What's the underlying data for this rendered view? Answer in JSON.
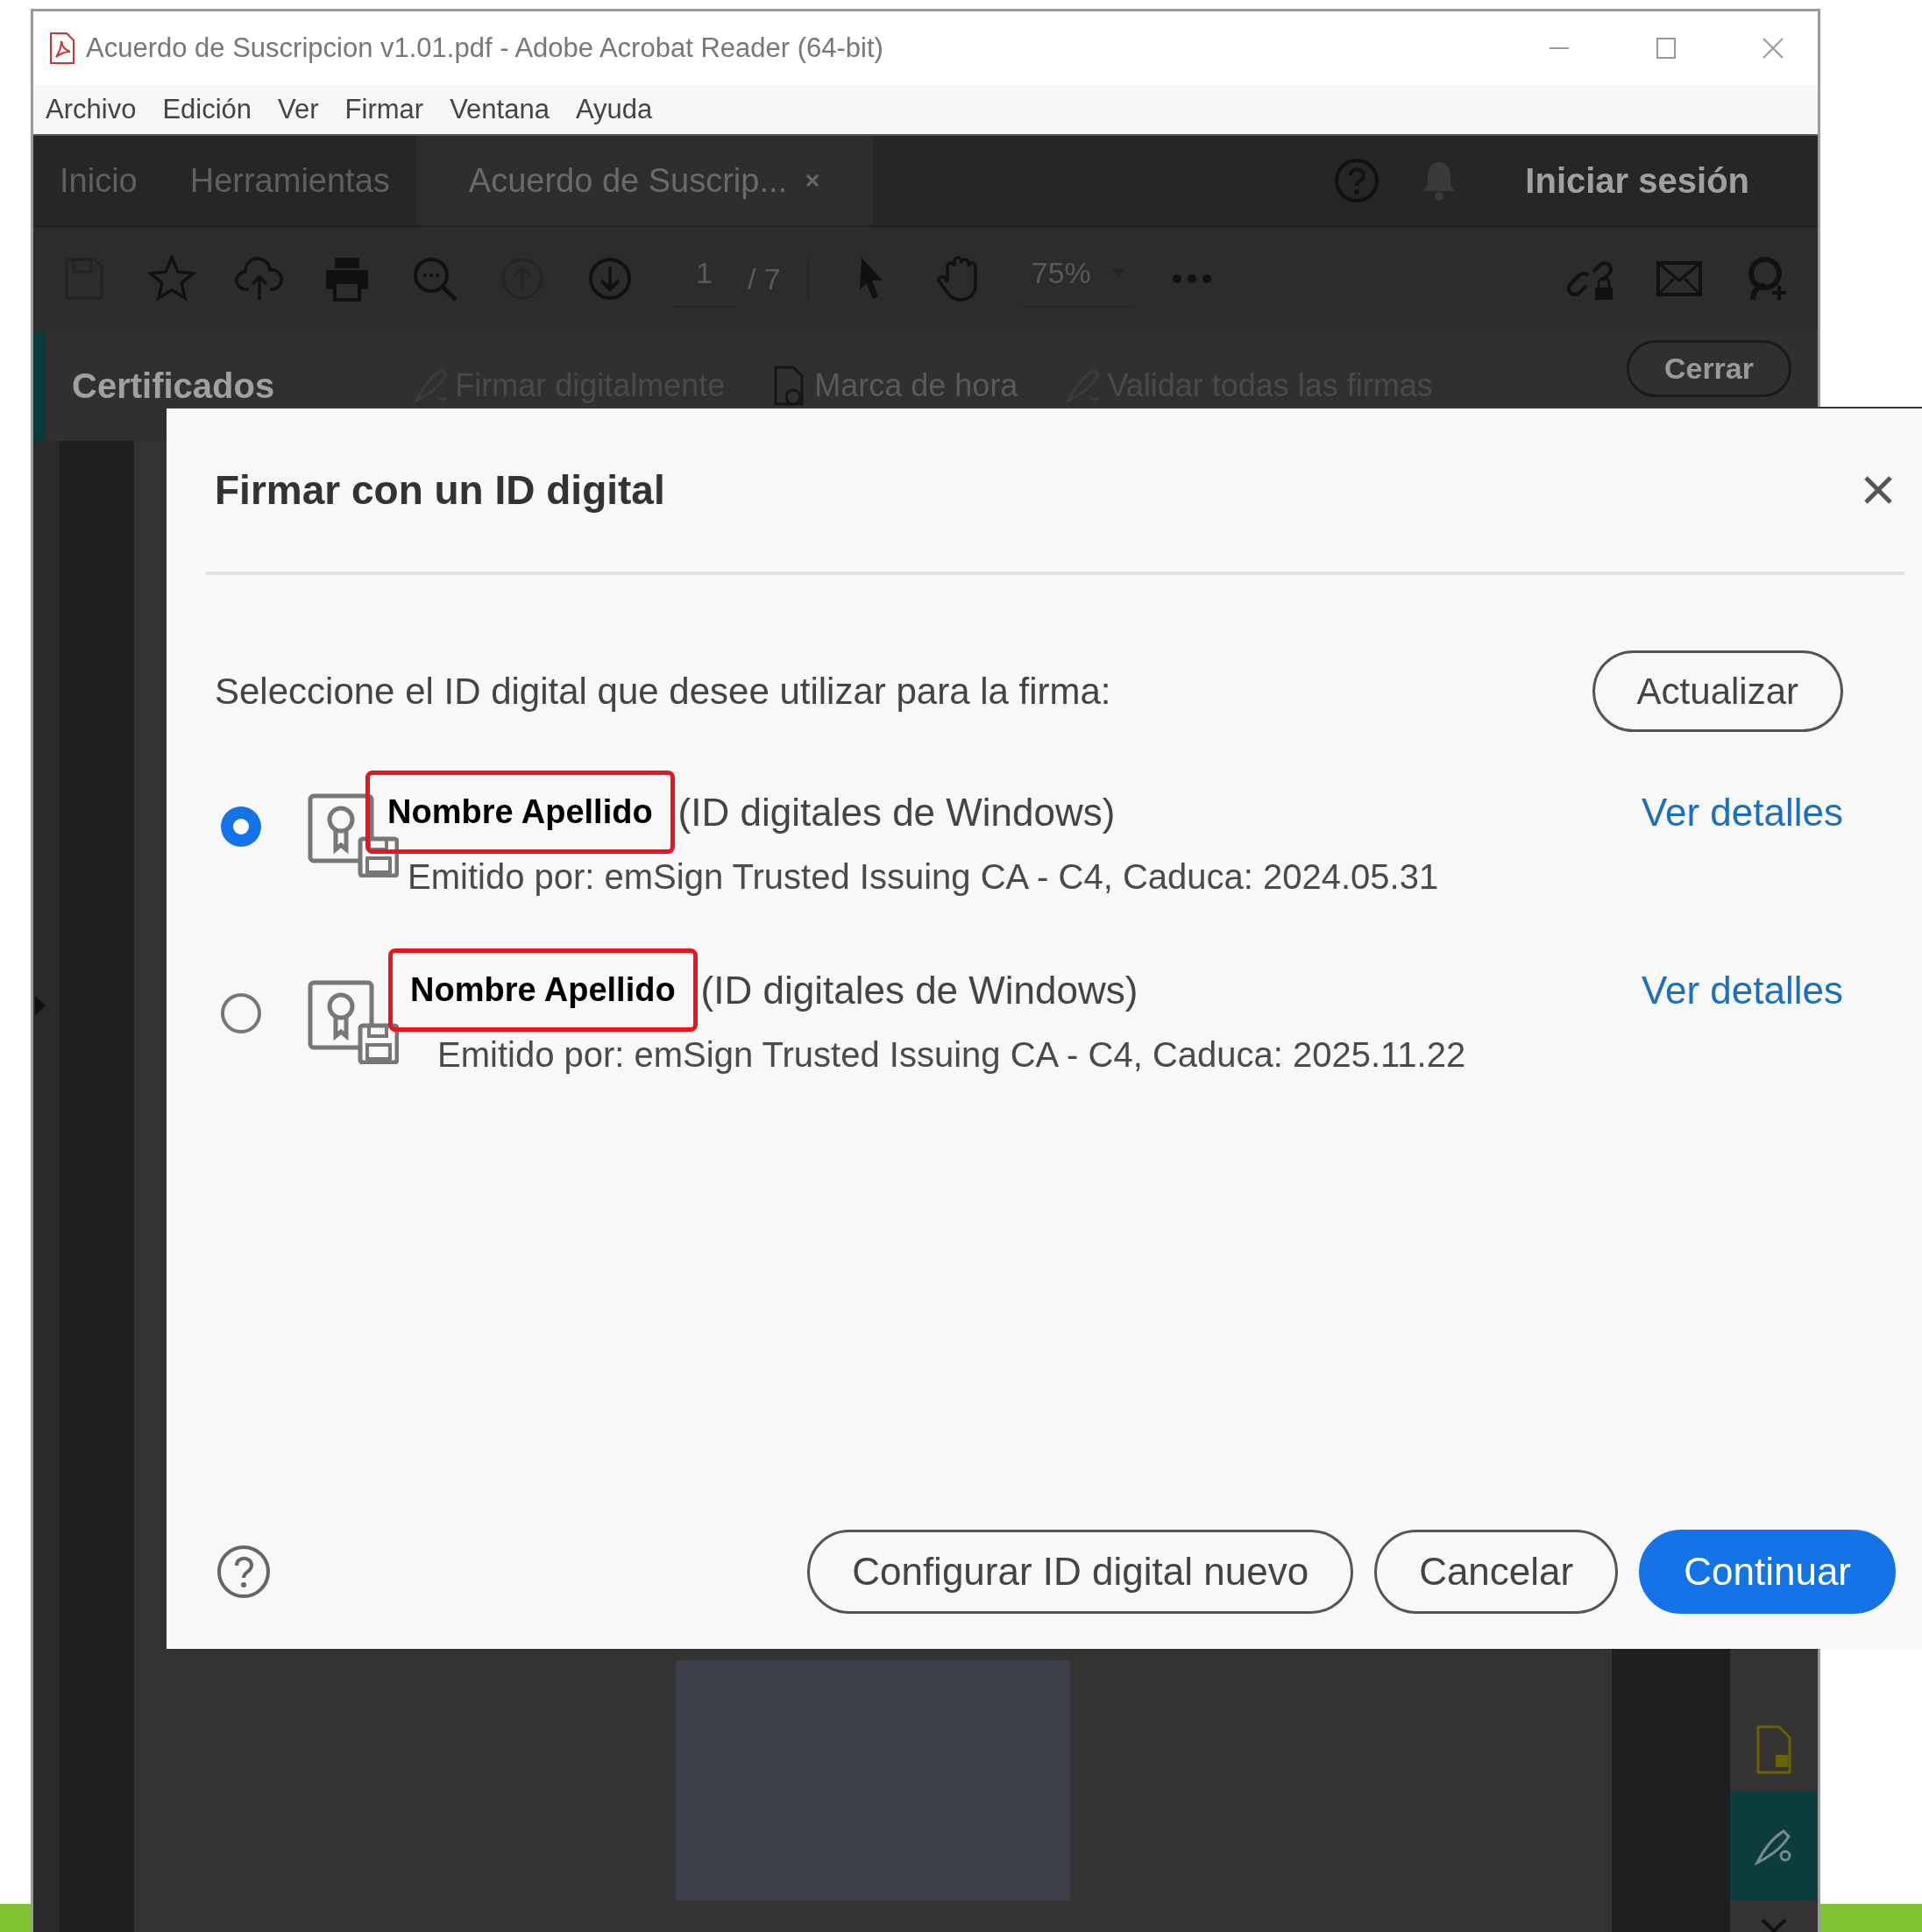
{
  "window": {
    "title": "Acuerdo de Suscripcion v1.01.pdf - Adobe Acrobat Reader (64-bit)"
  },
  "menu": [
    "Archivo",
    "Edición",
    "Ver",
    "Firmar",
    "Ventana",
    "Ayuda"
  ],
  "tabs": [
    {
      "label": "Inicio",
      "selected": false
    },
    {
      "label": "Herramientas",
      "selected": false
    },
    {
      "label": "Acuerdo de Suscrip...",
      "selected": true
    }
  ],
  "sign_in": "Iniciar sesión",
  "toolbar": {
    "page": "1",
    "page_total": "/ 7",
    "zoom": "75%"
  },
  "certificates_bar": {
    "title": "Certificados",
    "actions": [
      {
        "label": "Firmar digitalmente",
        "disabled": true
      },
      {
        "label": "Marca de hora",
        "disabled": false
      },
      {
        "label": "Validar todas las firmas",
        "disabled": true
      }
    ],
    "close": "Cerrar"
  },
  "dialog": {
    "title": "Firmar con un ID digital",
    "prompt": "Seleccione el ID digital que desee utilizar para la firma:",
    "refresh": "Actualizar",
    "ids": [
      {
        "name": "Nombre Apellido",
        "source": "(ID digitales de Windows)",
        "issuer": "Emitido por: emSign Trusted Issuing CA - C4,  Caduca: 2024.05.31",
        "details": "Ver detalles",
        "selected": true
      },
      {
        "name": "Nombre Apellido",
        "source": "(ID digitales de Windows)",
        "issuer": "Emitido por: emSign Trusted Issuing CA - C4, Caduca: 2025.11.22",
        "details": "Ver detalles",
        "selected": false
      }
    ],
    "buttons": [
      {
        "label": "Configurar ID digital nuevo",
        "kind": "secondary"
      },
      {
        "label": "Cancelar",
        "kind": "secondary"
      },
      {
        "label": "Continuar",
        "kind": "primary"
      }
    ]
  }
}
